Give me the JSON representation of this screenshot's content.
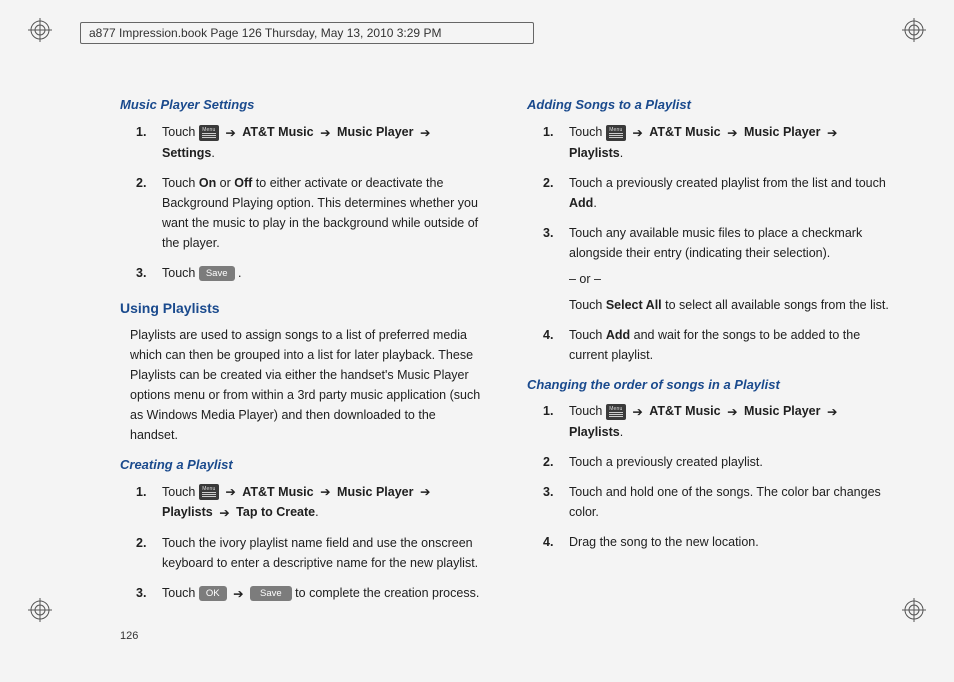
{
  "header": "a877 Impression.book  Page 126  Thursday, May 13, 2010  3:29 PM",
  "arrow": "➔",
  "buttons": {
    "save": "Save",
    "ok": "OK"
  },
  "menu_icon_name": "menu-icon",
  "left": {
    "h1": "Music Player Settings",
    "steps1": {
      "s1a": "Touch ",
      "s1b": " AT&T Music ",
      "s1c": " Music Player ",
      "s1d": " Settings",
      "s1e": ".",
      "s2a": "Touch ",
      "s2b": "On",
      "s2c": " or ",
      "s2d": "Off",
      "s2e": " to either activate or deactivate the Background Playing option. This determines whether you want the music to play in the background while outside of the player.",
      "s3a": "Touch ",
      "s3b": "."
    },
    "h2": "Using Playlists",
    "para": "Playlists are used to assign songs to a list of preferred media which can then be grouped into a list for later playback. These Playlists can be created via either the handset's Music Player options menu or from within a 3rd party music application (such as Windows Media Player) and then downloaded to the handset.",
    "h3": "Creating a Playlist",
    "steps2": {
      "s1a": "Touch ",
      "s1b": " AT&T Music ",
      "s1c": " Music Player ",
      "s1d": " Playlists ",
      "s1e": " Tap to Create",
      "s1f": ".",
      "s2": "Touch the ivory playlist name field and use the onscreen keyboard to enter a descriptive name for the new playlist.",
      "s3a": "Touch ",
      "s3b": " to complete the creation process."
    }
  },
  "right": {
    "h1": "Adding Songs to a Playlist",
    "steps1": {
      "s1a": "Touch ",
      "s1b": " AT&T Music ",
      "s1c": " Music Player ",
      "s1d": " Playlists",
      "s1e": ".",
      "s2a": "Touch a previously created playlist from the list and touch ",
      "s2b": "Add",
      "s2c": ".",
      "s3a": "Touch any available music files to place a checkmark alongside their entry (indicating their selection).",
      "s3or": "– or –",
      "s3b1": "Touch ",
      "s3b2": "Select All",
      "s3b3": " to select all available songs from the list.",
      "s4a": "Touch ",
      "s4b": "Add",
      "s4c": " and wait for the songs to be added to the current playlist."
    },
    "h2": "Changing the order of songs in a Playlist",
    "steps2": {
      "s1a": "Touch ",
      "s1b": " AT&T Music ",
      "s1c": " Music Player ",
      "s1d": " Playlists",
      "s1e": ".",
      "s2": "Touch a previously created playlist.",
      "s3": "Touch and hold one of the songs. The color bar changes color.",
      "s4": "Drag the song to the new location."
    }
  },
  "page_number": "126",
  "step_numbers": {
    "n1": "1.",
    "n2": "2.",
    "n3": "3.",
    "n4": "4."
  }
}
